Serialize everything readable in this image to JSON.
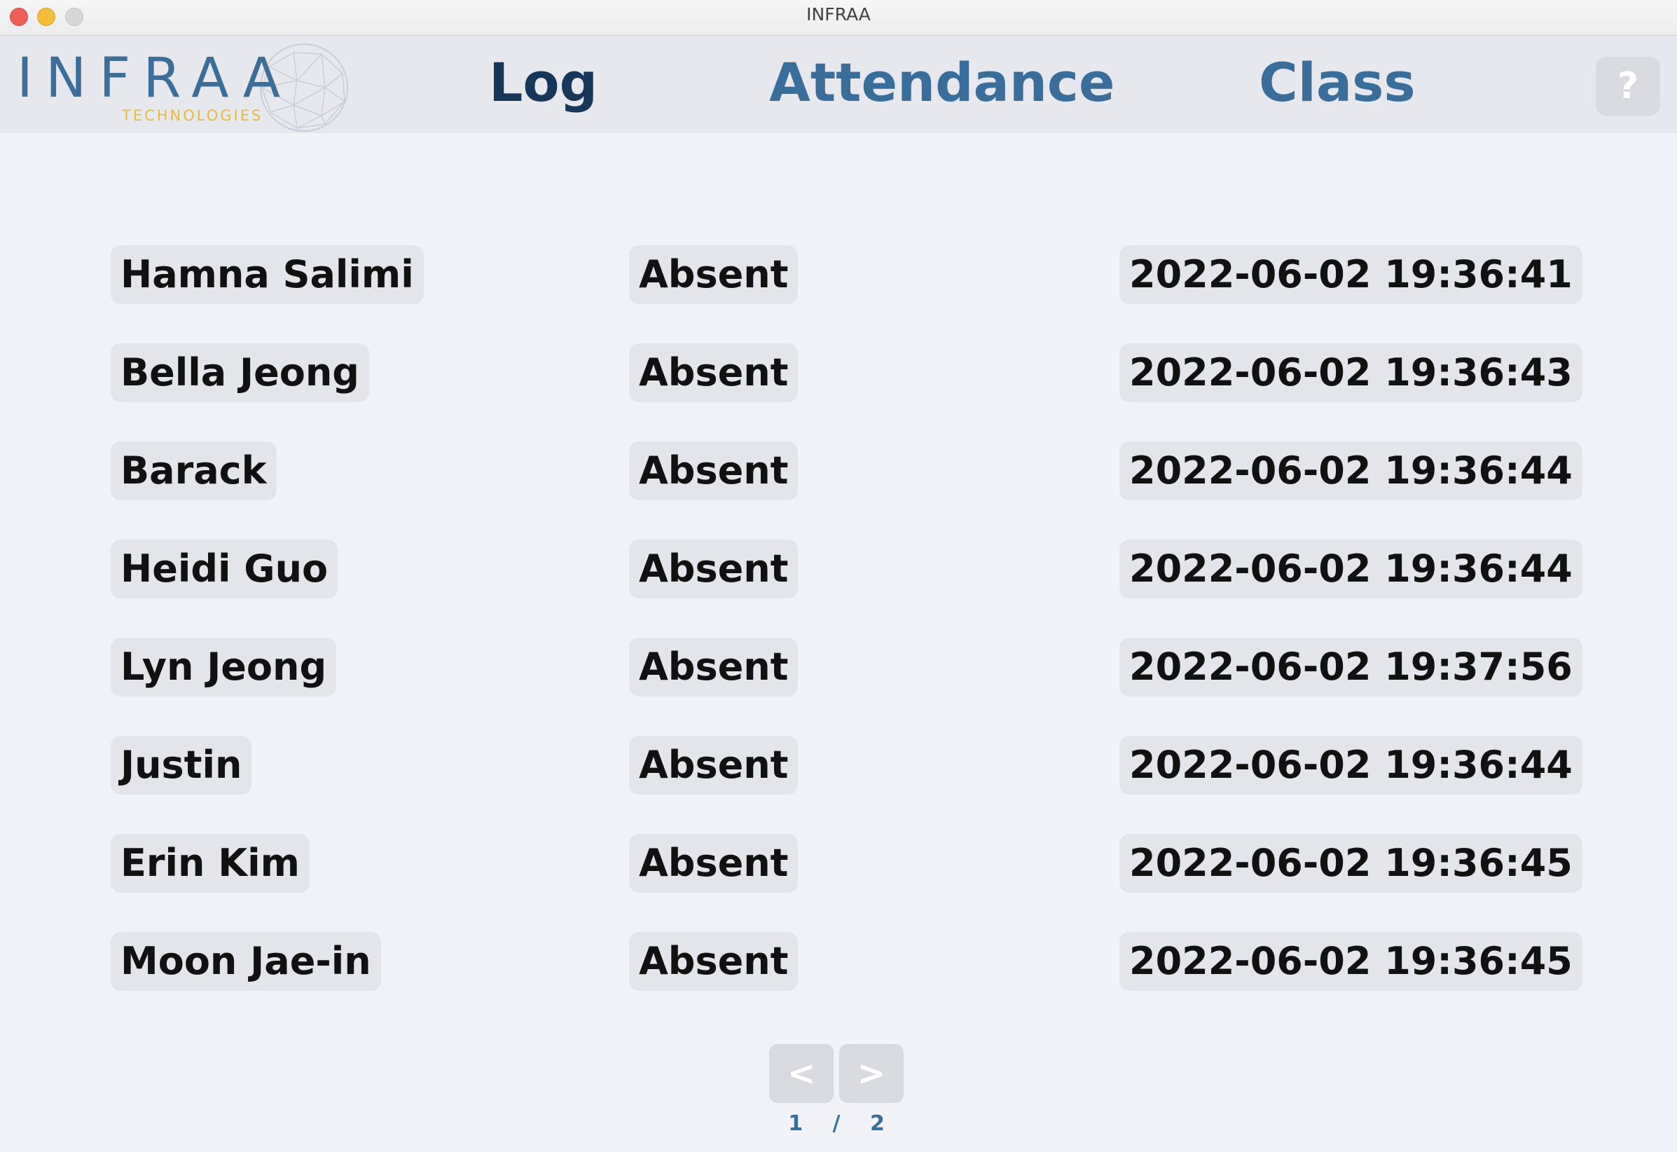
{
  "window": {
    "title": "INFRAA"
  },
  "logo": {
    "main": "INFRAA",
    "sub": "TECHNOLOGIES"
  },
  "nav": {
    "log": "Log",
    "attendance": "Attendance",
    "class": "Class",
    "help": "?"
  },
  "records": [
    {
      "name": "Hamna Salimi",
      "status": "Absent",
      "time": "2022-06-02 19:36:41"
    },
    {
      "name": "Bella Jeong",
      "status": "Absent",
      "time": "2022-06-02 19:36:43"
    },
    {
      "name": "Barack",
      "status": "Absent",
      "time": "2022-06-02 19:36:44"
    },
    {
      "name": "Heidi Guo",
      "status": "Absent",
      "time": "2022-06-02 19:36:44"
    },
    {
      "name": "Lyn Jeong",
      "status": "Absent",
      "time": "2022-06-02 19:37:56"
    },
    {
      "name": "Justin",
      "status": "Absent",
      "time": "2022-06-02 19:36:44"
    },
    {
      "name": "Erin Kim",
      "status": "Absent",
      "time": "2022-06-02 19:36:45"
    },
    {
      "name": "Moon Jae-in",
      "status": "Absent",
      "time": "2022-06-02 19:36:45"
    }
  ],
  "pagination": {
    "prev": "<",
    "next": ">",
    "current": "1",
    "separator": "/",
    "total": "2"
  },
  "colors": {
    "active_nav": "#16375a",
    "nav": "#3a6e9a",
    "logo_accent": "#e8b93c"
  }
}
